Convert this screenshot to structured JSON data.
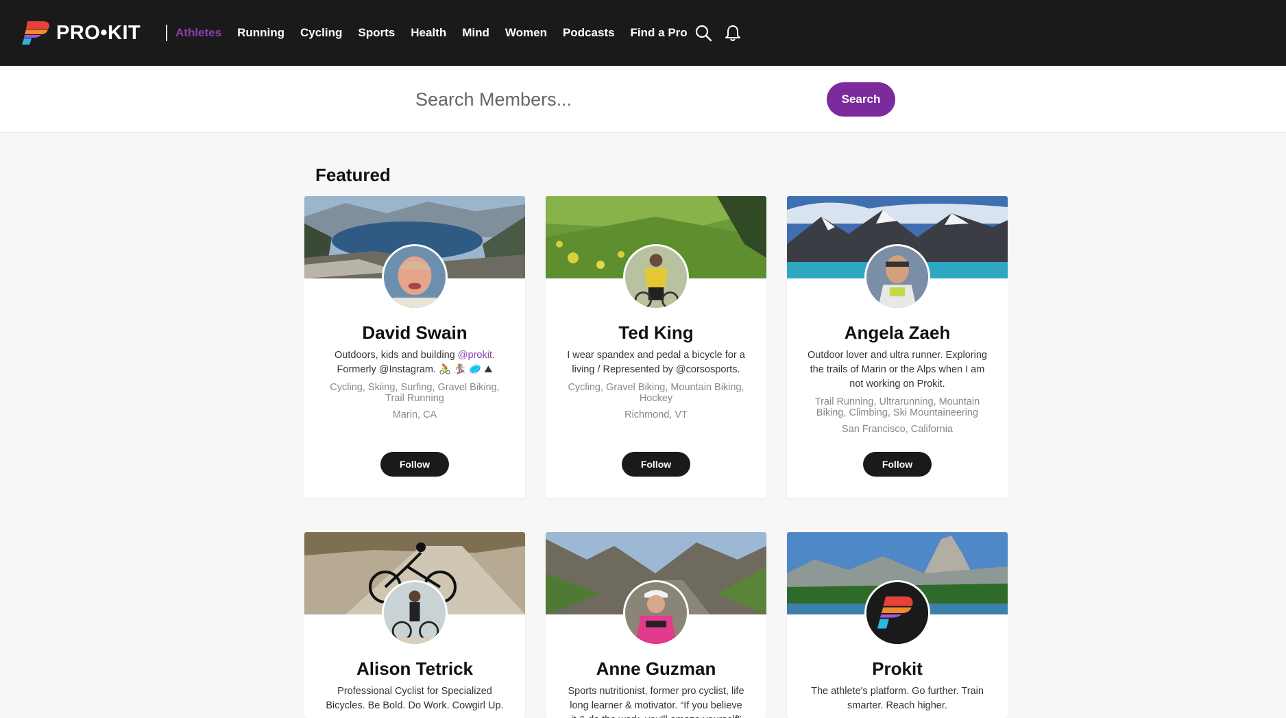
{
  "brand": {
    "name": "PRO•KIT"
  },
  "colors": {
    "accent": "#7b2b9c",
    "nav_bg": "#1a1a1a",
    "active_link": "#8a3fae"
  },
  "nav": {
    "links": [
      {
        "label": "Athletes",
        "active": true
      },
      {
        "label": "Running"
      },
      {
        "label": "Cycling"
      },
      {
        "label": "Sports"
      },
      {
        "label": "Health"
      },
      {
        "label": "Mind"
      },
      {
        "label": "Women"
      },
      {
        "label": "Podcasts"
      },
      {
        "label": "Find a Pro"
      }
    ],
    "icons": [
      "search-icon",
      "bell-icon"
    ]
  },
  "search": {
    "placeholder": "Search Members...",
    "button_label": "Search"
  },
  "featured": {
    "title": "Featured",
    "follow_label": "Follow",
    "cards": [
      {
        "name": "David Swain",
        "bio_prefix": "Outdoors, kids and building ",
        "bio_link": "@prokit",
        "bio_suffix": ". Formerly @Instagram. 🚴 🏂 🥏 ⛰",
        "tags": "Cycling, Skiing, Surfing, Gravel Biking, Trail Running",
        "location": "Marin, CA"
      },
      {
        "name": "Ted King",
        "bio": "I wear spandex and pedal a bicycle for a living / Represented by @corsosports.",
        "tags": "Cycling, Gravel Biking, Mountain Biking, Hockey",
        "location": "Richmond, VT"
      },
      {
        "name": "Angela Zaeh",
        "bio": "Outdoor lover and ultra runner. Exploring the trails of Marin or the Alps when I am not working on Prokit.",
        "tags": "Trail Running, Ultrarunning, Mountain Biking, Climbing, Ski Mountaineering",
        "location": "San Francisco, California"
      },
      {
        "name": "Alison Tetrick",
        "bio": "Professional Cyclist for Specialized Bicycles. Be Bold. Do Work. Cowgirl Up."
      },
      {
        "name": "Anne Guzman",
        "bio": "Sports nutritionist, former pro cyclist, life long learner & motivator. “If you believe it & do the work, you'll amaze yourself”"
      },
      {
        "name": "Prokit",
        "bio": "The athlete's platform. Go further. Train smarter. Reach higher."
      }
    ]
  }
}
